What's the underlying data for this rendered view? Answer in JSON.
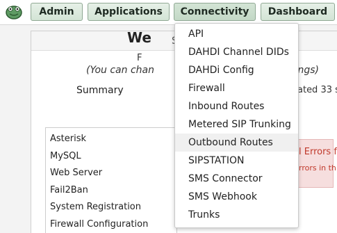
{
  "nav": {
    "logo_icon": "frog-logo-icon",
    "buttons": [
      "Admin",
      "Applications",
      "Connectivity",
      "Dashboard"
    ]
  },
  "page": {
    "header_fragment": "S",
    "welcome": "We",
    "line_f": "F",
    "hint": "(You can chan",
    "hint_right": "ettings)",
    "summary_title": "Summary",
    "updated": "ated 33 se",
    "summary_items": [
      "Asterisk",
      "MySQL",
      "Web Server",
      "Fail2Ban",
      "System Registration",
      "Firewall Configuration"
    ],
    "error_title": "l Errors fo",
    "error_text": "rrors in th"
  },
  "dropdown": {
    "items": [
      "API",
      "DAHDI Channel DIDs",
      "DAHDi Config",
      "Firewall",
      "Inbound Routes",
      "Metered SIP Trunking",
      "Outbound Routes",
      "SIPSTATION",
      "SMS Connector",
      "SMS Webhook",
      "Trunks"
    ],
    "hovered": "Outbound Routes"
  },
  "colors": {
    "nav_button_bg": "#d3e4d5",
    "nav_button_border": "#8fa893",
    "error_bg": "#f6dede",
    "error_text": "#c0392b"
  }
}
